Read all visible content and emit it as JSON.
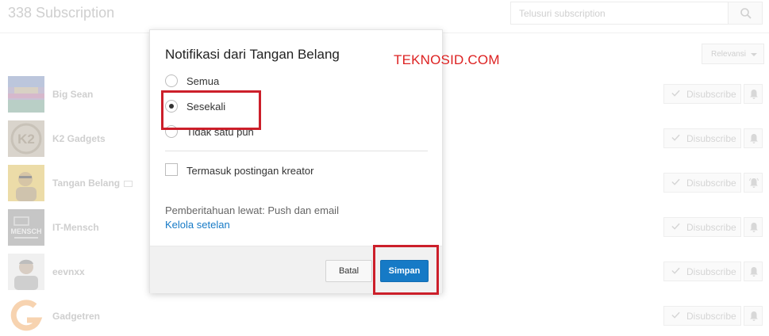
{
  "page": {
    "title": "338 Subscription",
    "search_placeholder": "Telusuri subscription",
    "sort_label": "Relevansi"
  },
  "channels": [
    {
      "name": "Big Sean",
      "button": "Disubscribe"
    },
    {
      "name": "K2 Gadgets",
      "button": "Disubscribe"
    },
    {
      "name": "Tangan Belang",
      "button": "Disubscribe"
    },
    {
      "name": "IT-Mensch",
      "button": "Disubscribe"
    },
    {
      "name": "eevnxx",
      "button": "Disubscribe"
    },
    {
      "name": "Gadgetren",
      "button": "Disubscribe"
    }
  ],
  "avatars": {
    "k2_text": "K2",
    "itmensch_text": "MENSCH"
  },
  "dialog": {
    "title": "Notifikasi dari Tangan Belang",
    "options": [
      {
        "label": "Semua",
        "selected": false
      },
      {
        "label": "Sesekali",
        "selected": true
      },
      {
        "label": "Tidak satu pun",
        "selected": false
      }
    ],
    "include_posts_label": "Termasuk postingan kreator",
    "include_posts_checked": false,
    "notify_via": "Pemberitahuan lewat: Push dan email",
    "manage_link": "Kelola setelan",
    "cancel_label": "Batal",
    "save_label": "Simpan"
  },
  "watermark": "TEKNOSID.COM",
  "colors": {
    "accent": "#167ac6",
    "annotation": "#cc1f2a"
  }
}
